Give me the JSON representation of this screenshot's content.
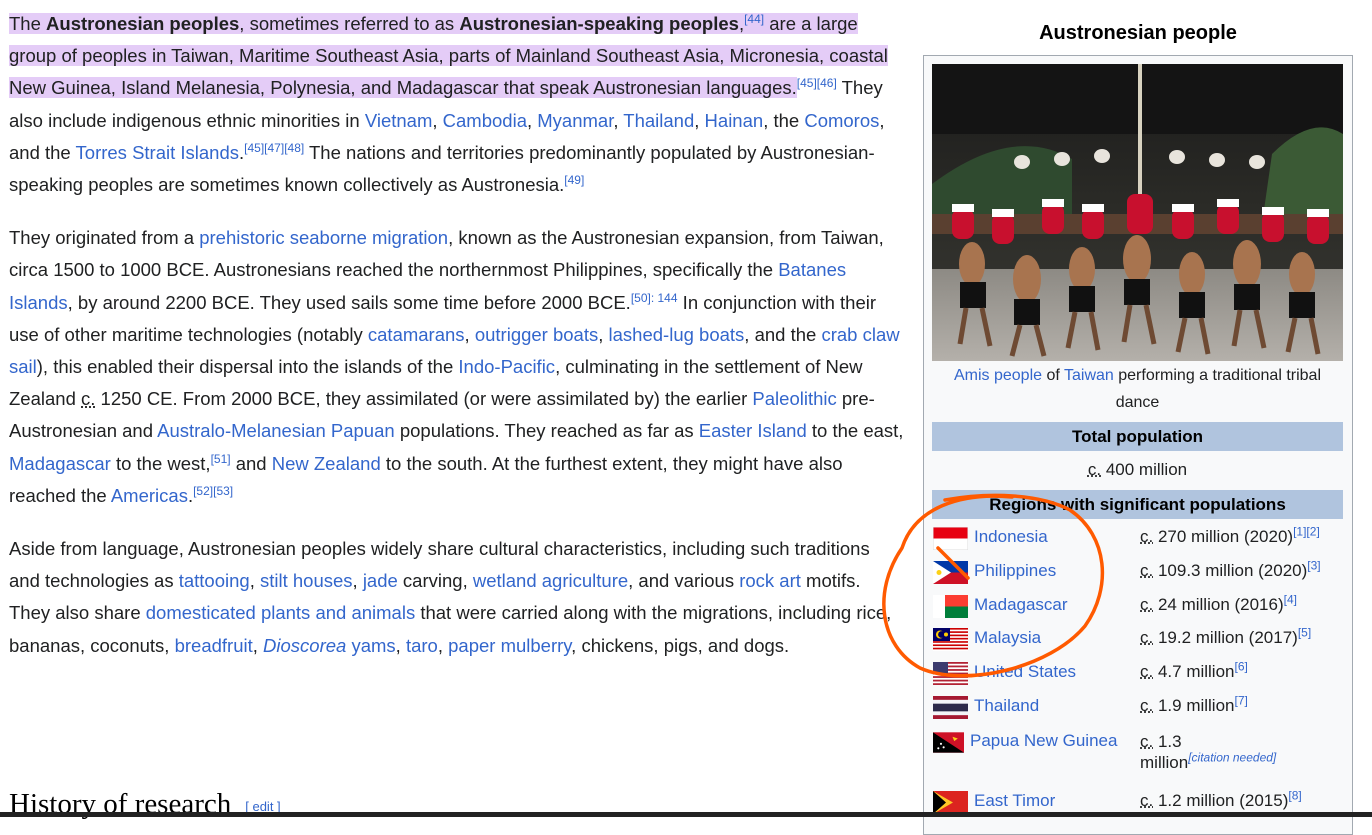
{
  "article": {
    "p1": {
      "s1a": "The ",
      "b1": "Austronesian peoples",
      "s1b": ", sometimes referred to as ",
      "b2": "Austronesian-speaking peoples",
      "s1c": ",",
      "ref1": "[44]",
      "s1d": " are a large group of peoples in Taiwan, Maritime Southeast Asia, parts of Mainland Southeast Asia, Micronesia, coastal New Guinea, Island Melanesia, Polynesia, and Madagascar that speak Austronesian languages.",
      "ref2": "[45][46]",
      "s2a": " They also include indigenous ethnic minorities in ",
      "l_vietnam": "Vietnam",
      "l_cambodia": "Cambodia",
      "l_myanmar": "Myanmar",
      "l_thailand": "Thailand",
      "l_hainan": "Hainan",
      "s2b": ", the ",
      "l_comoros": "Comoros",
      "s2c": ", and the ",
      "l_torres": "Torres Strait Islands",
      "ref3": "[45][47][48]",
      "s3": " The nations and territories predominantly populated by Austronesian-speaking peoples are sometimes known collectively as Austronesia.",
      "ref4": "[49]"
    },
    "p2": {
      "a": "They originated from a ",
      "l_migration": "prehistoric seaborne migration",
      "b": ", known as the Austronesian expansion, from Taiwan, circa 1500 to 1000 BCE. Austronesians reached the northernmost Philippines, specifically the ",
      "l_batanes": "Batanes Islands",
      "c": ", by around 2200 BCE. They used sails some time before 2000 BCE.",
      "ref1": "[50]: 144",
      "d": " In conjunction with their use of other maritime technologies (notably ",
      "l_catamarans": "catamarans",
      "l_outrigger": "outrigger boats",
      "l_lashed": "lashed-lug boats",
      "e": ", and the ",
      "l_crab": "crab claw sail",
      "f": "), this enabled their dispersal into the islands of the ",
      "l_indo": "Indo-Pacific",
      "g": ", culminating in the settlement of New Zealand ",
      "circa": "c.",
      "h": " 1250 CE. From 2000 BCE, they assimilated (or were assimilated by) the earlier ",
      "l_paleolithic": "Paleolithic",
      "i": " pre-Austronesian and ",
      "l_papuan": "Australo-Melanesian Papuan",
      "j": " populations. They reached as far as ",
      "l_easter": "Easter Island",
      "k": " to the east, ",
      "l_madagascar": "Madagascar",
      "l": " to the west,",
      "ref2": "[51]",
      "m": " and ",
      "l_nz": "New Zealand",
      "n": " to the south. At the furthest extent, they might have also reached the ",
      "l_americas": "Americas",
      "o": ".",
      "ref3": "[52][53]"
    },
    "p3": {
      "a": "Aside from language, Austronesian peoples widely share cultural characteristics, including such traditions and technologies as ",
      "l_tattooing": "tattooing",
      "l_stilt": "stilt houses",
      "l_jade": "jade",
      "b": " carving, ",
      "l_wetland": "wetland agriculture",
      "c": ", and various ",
      "l_rockart": "rock art",
      "d": " motifs. They also share ",
      "l_domesticated": "domesticated plants and animals",
      "e": " that were carried along with the migrations, including rice, bananas, coconuts, ",
      "l_breadfruit": "breadfruit",
      "l_dioscorea": "Dioscorea",
      "l_yams": "yams",
      "l_taro": "taro",
      "l_mulberry": "paper mulberry",
      "f": ", chickens, pigs, and dogs."
    },
    "heading": "History of research",
    "edit": "[ edit ]"
  },
  "infobox": {
    "title": "Austronesian people",
    "caption": {
      "l_amis": "Amis people",
      "of": " of ",
      "l_taiwan": "Taiwan",
      "rest": " performing a traditional tribal dance"
    },
    "total_header": "Total population",
    "total_circa": "c.",
    "total_value": " 400 million",
    "regions_header": "Regions with significant populations",
    "rows": [
      {
        "name": "Indonesia",
        "circa": "c.",
        "value": " 270 million (2020)",
        "ref": "[1][2]",
        "flag": "indonesia-flag-icon"
      },
      {
        "name": "Philippines",
        "circa": "c.",
        "value": " 109.3 million (2020)",
        "ref": "[3]",
        "flag": "philippines-flag-icon"
      },
      {
        "name": "Madagascar",
        "circa": "c.",
        "value": " 24 million (2016)",
        "ref": "[4]",
        "flag": "madagascar-flag-icon"
      },
      {
        "name": "Malaysia",
        "circa": "c.",
        "value": " 19.2 million (2017)",
        "ref": "[5]",
        "flag": "malaysia-flag-icon"
      },
      {
        "name": "United States",
        "circa": "c.",
        "value": " 4.7 million",
        "ref": "[6]",
        "flag": "us-flag-icon"
      },
      {
        "name": "Thailand",
        "circa": "c.",
        "value": " 1.9 million",
        "ref": "[7]",
        "flag": "thailand-flag-icon"
      },
      {
        "name": "Papua New Guinea",
        "circa": "c.",
        "value": " 1.3",
        "value2": "million",
        "ref": "[citation needed]",
        "flag": "png-flag-icon"
      },
      {
        "name": "East Timor",
        "circa": "c.",
        "value": " 1.2 million (2015)",
        "ref": "[8]",
        "flag": "east-timor-flag-icon"
      }
    ]
  },
  "annotation": {
    "color": "#ff5a00"
  }
}
